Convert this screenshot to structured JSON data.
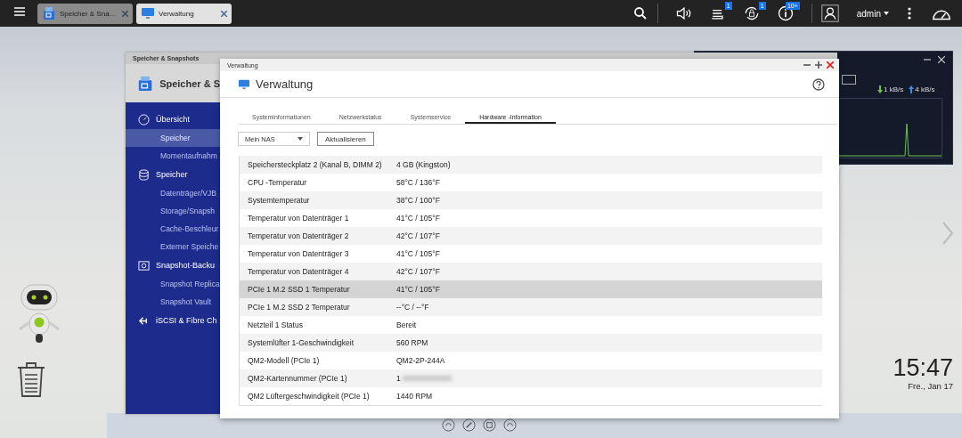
{
  "top_bar": {
    "tabs": [
      {
        "label": "Speicher & Sna...",
        "selected": false
      },
      {
        "label": "Verwaltung",
        "selected": true
      }
    ],
    "notifications": [
      {
        "kind": "tasks",
        "badge": "1"
      },
      {
        "kind": "backup",
        "badge": "1"
      },
      {
        "kind": "info",
        "badge": "10+"
      }
    ],
    "user": "admin"
  },
  "back_window": {
    "title": "Speicher & Snapshots",
    "app_name": "Speicher & S",
    "nav": [
      {
        "label": "Übersicht",
        "children": [
          {
            "label": "Speicher",
            "selected": true
          },
          {
            "label": "Momentaufnahm",
            "selected": false
          }
        ]
      },
      {
        "label": "Speicher",
        "children": [
          {
            "label": "Datenträger/VJB",
            "selected": false
          },
          {
            "label": "Storage/Snapsh",
            "selected": false
          },
          {
            "label": "Cache-Beschleur",
            "selected": false
          },
          {
            "label": "Externer Speiche",
            "selected": false
          }
        ]
      },
      {
        "label": "Snapshot-Backu",
        "children": [
          {
            "label": "Snapshot Replica",
            "selected": false
          },
          {
            "label": "Snapshot Vault",
            "selected": false
          }
        ]
      },
      {
        "label": "iSCSI & Fibre Ch"
      }
    ]
  },
  "resource_monitor": {
    "download": "1 kB/s",
    "upload": "4 kB/s"
  },
  "window": {
    "title": "Verwaltung",
    "heading": "Verwaltung",
    "tabs": [
      {
        "label": "Systeminformationen",
        "selected": false
      },
      {
        "label": "Netzwerkstatus",
        "selected": false
      },
      {
        "label": "Systemservice",
        "selected": false
      },
      {
        "label": "Hardware -Information",
        "selected": true
      }
    ],
    "device_select": {
      "value": "Mein NAS"
    },
    "refresh_button": "Aktualisieren",
    "table": {
      "rows": [
        {
          "name": "Speichersteckplatz 2 (Kanal B, DIMM 2)",
          "value": "4 GB (Kingston)",
          "selected": false
        },
        {
          "name": "CPU -Temperatur",
          "value": "58°C / 136°F",
          "selected": false
        },
        {
          "name": "Systemtemperatur",
          "value": "38°C / 100°F",
          "selected": false
        },
        {
          "name": "Temperatur von Datenträger 1",
          "value": "41°C / 105°F",
          "selected": false
        },
        {
          "name": "Temperatur von Datenträger 2",
          "value": "42°C / 107°F",
          "selected": false
        },
        {
          "name": "Temperatur von Datenträger 3",
          "value": "41°C / 105°F",
          "selected": false
        },
        {
          "name": "Temperatur von Datenträger 4",
          "value": "42°C / 107°F",
          "selected": false
        },
        {
          "name": "PCIe 1 M.2 SSD 1 Temperatur",
          "value": "41°C / 105°F",
          "selected": true
        },
        {
          "name": "PCIe 1 M.2 SSD 2 Temperatur",
          "value": "--°C / --°F",
          "selected": false
        },
        {
          "name": "Netzteil 1 Status",
          "value": "Bereit",
          "selected": false
        },
        {
          "name": "Systemlüfter 1-Geschwindigkeit",
          "value": "560 RPM",
          "selected": false
        },
        {
          "name": "QM2-Modell (PCIe 1)",
          "value": "QM2-2P-244A",
          "selected": false
        },
        {
          "name": "QM2-Kartennummer (PCIe 1)",
          "value": "1",
          "redacted": true,
          "selected": false
        },
        {
          "name": "QM2 Lüftergeschwindigkeit (PCIe 1)",
          "value": "1440 RPM",
          "selected": false
        }
      ]
    }
  },
  "clock": {
    "time": "15:47",
    "date": "Fre., Jan 17"
  }
}
